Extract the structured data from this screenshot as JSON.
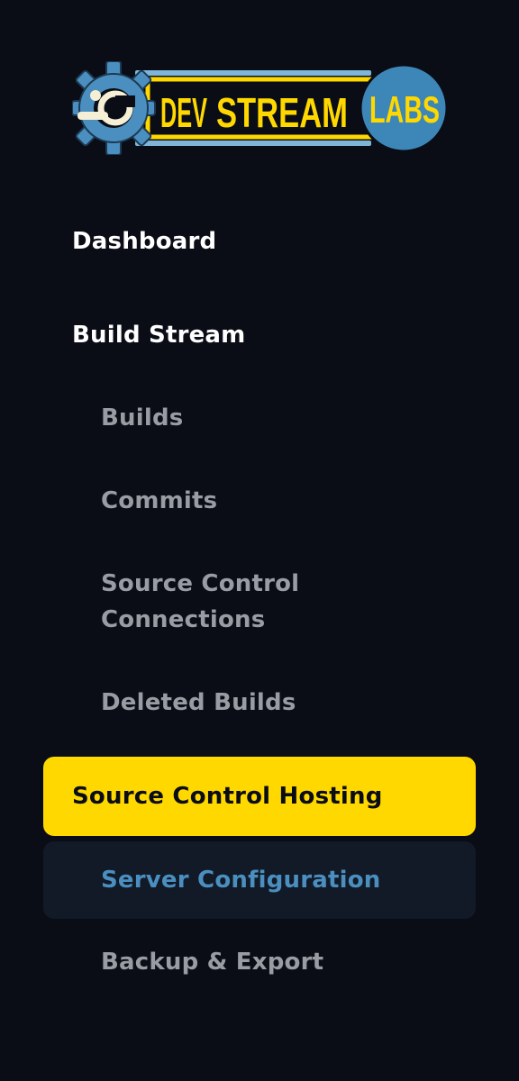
{
  "brand": {
    "word_dev": "DEV",
    "word_stream": "STREAM",
    "word_labs": "LABS",
    "colors": {
      "gear": "#4a8fc0",
      "text_yellow": "#ffd800",
      "badge_blue": "#3d87b8"
    }
  },
  "nav": {
    "dashboard": "Dashboard",
    "build_stream": "Build Stream",
    "builds": "Builds",
    "commits": "Commits",
    "source_control_connections_line1": "Source Control",
    "source_control_connections_line2": "Connections",
    "deleted_builds": "Deleted Builds",
    "source_control_hosting": "Source Control Hosting",
    "server_configuration": "Server Configuration",
    "backup_export": "Backup & Export"
  },
  "colors": {
    "background": "#0a0c16",
    "active_parent_bg": "#ffd800",
    "active_child_bg": "#111a26",
    "active_child_text": "#4a8fc0",
    "sub_text": "#9a9ca3",
    "top_text": "#ffffff"
  }
}
